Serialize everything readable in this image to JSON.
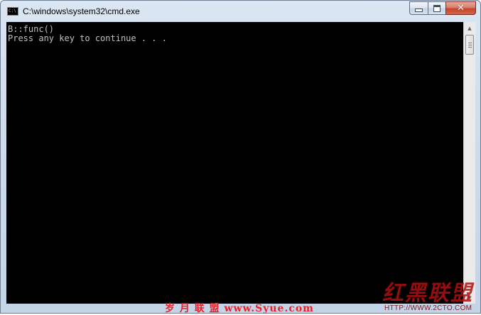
{
  "window": {
    "title": "C:\\windows\\system32\\cmd.exe",
    "icon": "cmd-icon",
    "icon_label": "C:\\",
    "buttons": {
      "minimize": "minimize-icon",
      "maximize": "maximize-icon",
      "close": "close-icon",
      "close_glyph": "✕"
    }
  },
  "console": {
    "lines": [
      "B::func()",
      "Press any key to continue . . ."
    ],
    "background": "#000000",
    "foreground": "#c0c0c0"
  },
  "scrollbar": {
    "up_arrow": "▲",
    "down_arrow": "▼"
  },
  "watermarks": {
    "left": "岁 月 联 盟  www.Syue.com",
    "right": "红黑联盟",
    "url": "HTTP://WWW.2CTO.COM"
  }
}
